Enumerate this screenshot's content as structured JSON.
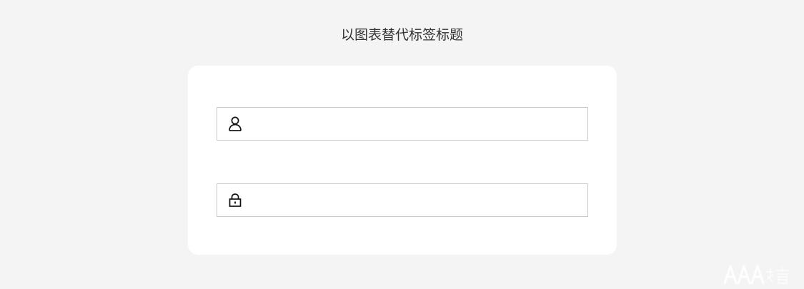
{
  "header": {
    "title": "以图表替代标签标题"
  },
  "form": {
    "username": {
      "icon": "user-icon",
      "value": "",
      "placeholder": ""
    },
    "password": {
      "icon": "lock-icon",
      "value": "",
      "placeholder": ""
    }
  },
  "watermark": {
    "text": "AAA教育"
  },
  "colors": {
    "page_background": "#f4f4f4",
    "card_background": "#ffffff",
    "field_border": "#c9c9c9",
    "icon": "#111111",
    "title_text": "#333333"
  }
}
